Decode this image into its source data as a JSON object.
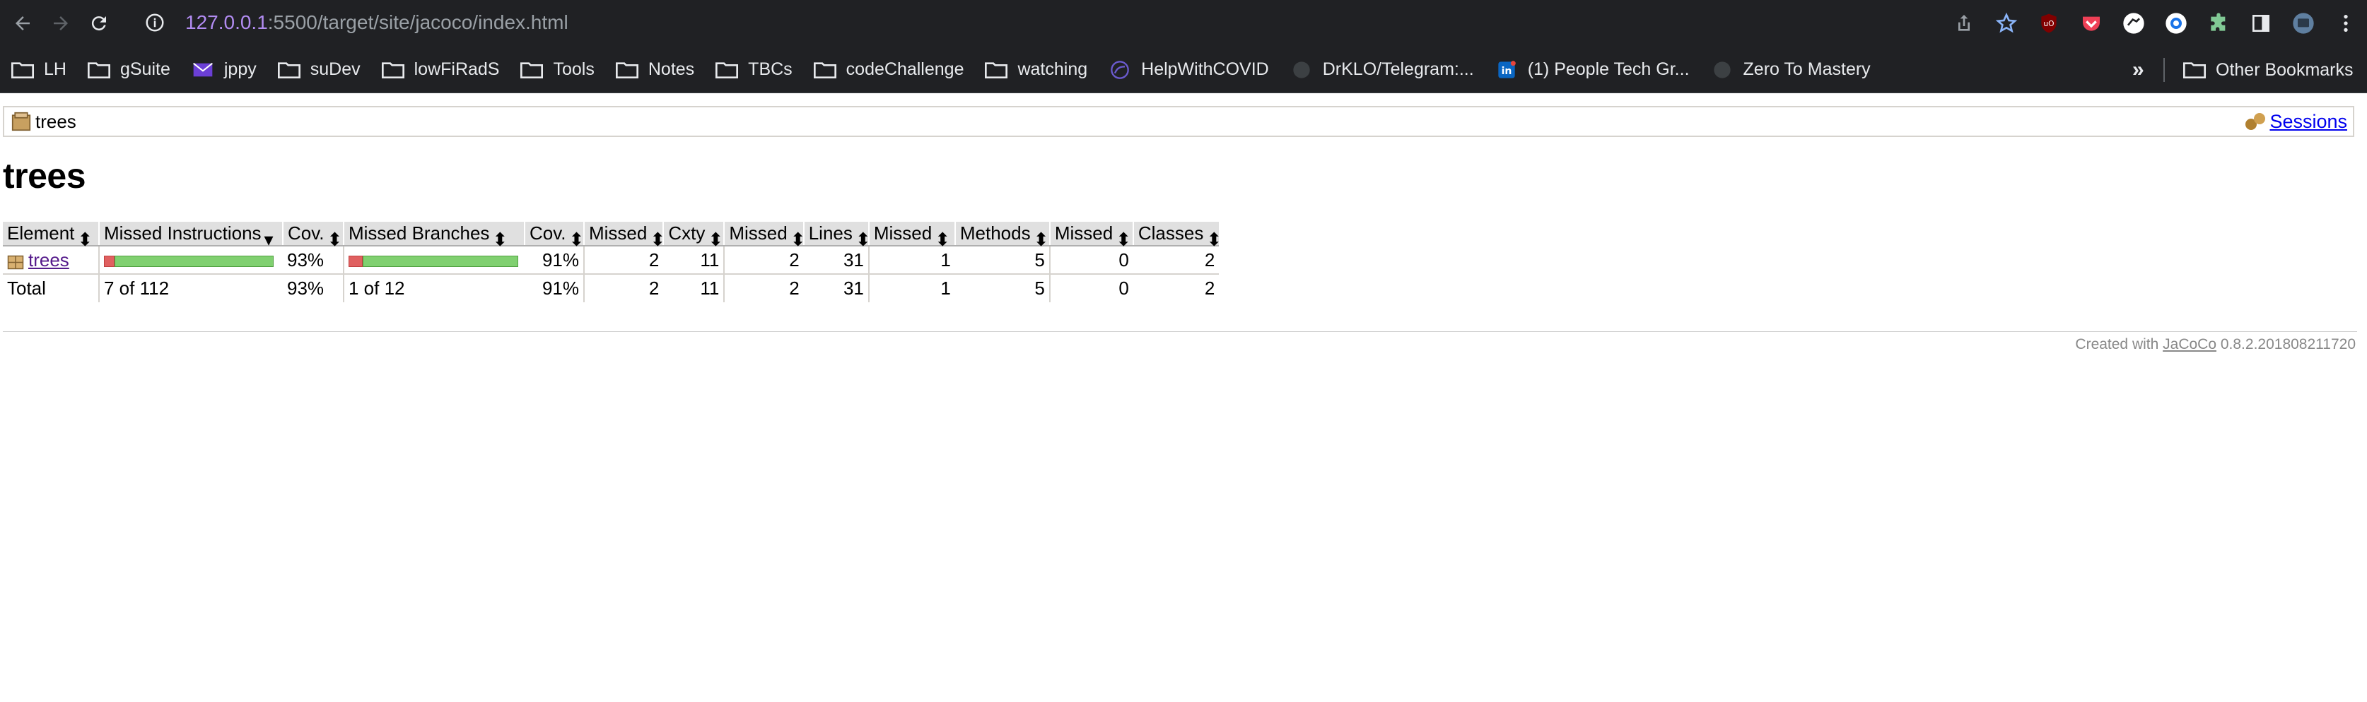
{
  "browser": {
    "url_host": "127.0.0.1",
    "url_path": ":5500/target/site/jacoco/index.html",
    "bookmarks": [
      {
        "label": "LH",
        "icon": "folder-icon"
      },
      {
        "label": "gSuite",
        "icon": "folder-icon"
      },
      {
        "label": "jppy",
        "icon": "mail-icon"
      },
      {
        "label": "suDev",
        "icon": "folder-icon"
      },
      {
        "label": "lowFiRadS",
        "icon": "folder-icon"
      },
      {
        "label": "Tools",
        "icon": "folder-icon"
      },
      {
        "label": "Notes",
        "icon": "folder-icon"
      },
      {
        "label": "TBCs",
        "icon": "folder-icon"
      },
      {
        "label": "codeChallenge",
        "icon": "folder-icon"
      },
      {
        "label": "watching",
        "icon": "folder-icon"
      },
      {
        "label": "HelpWithCOVID",
        "icon": "site-icon"
      },
      {
        "label": "DrKLO/Telegram:...",
        "icon": "github-icon"
      },
      {
        "label": "(1) People Tech Gr...",
        "icon": "linkedin-icon"
      },
      {
        "label": "Zero To Mastery",
        "icon": "github-icon"
      }
    ],
    "more_label": "»",
    "other_bookmarks": "Other Bookmarks"
  },
  "page": {
    "breadcrumb": "trees",
    "sessions": "Sessions",
    "title": "trees",
    "columns": [
      "Element",
      "Missed Instructions",
      "Cov.",
      "Missed Branches",
      "Cov.",
      "Missed",
      "Cxty",
      "Missed",
      "Lines",
      "Missed",
      "Methods",
      "Missed",
      "Classes"
    ],
    "rows": [
      {
        "element": "trees",
        "instr_missed_ratio": 0.0625,
        "instr_cov": "93%",
        "branch_missed_ratio": 0.083,
        "branch_cov": "91%",
        "cxty_missed": "2",
        "cxty": "11",
        "lines_missed": "2",
        "lines": "31",
        "methods_missed": "1",
        "methods": "5",
        "classes_missed": "0",
        "classes": "2"
      }
    ],
    "total": {
      "label": "Total",
      "instr": "7 of 112",
      "instr_cov": "93%",
      "branch": "1 of 12",
      "branch_cov": "91%",
      "cxty_missed": "2",
      "cxty": "11",
      "lines_missed": "2",
      "lines": "31",
      "methods_missed": "1",
      "methods": "5",
      "classes_missed": "0",
      "classes": "2"
    },
    "footer_prefix": "Created with",
    "footer_link": "JaCoCo",
    "footer_version": "0.8.2.201808211720"
  }
}
